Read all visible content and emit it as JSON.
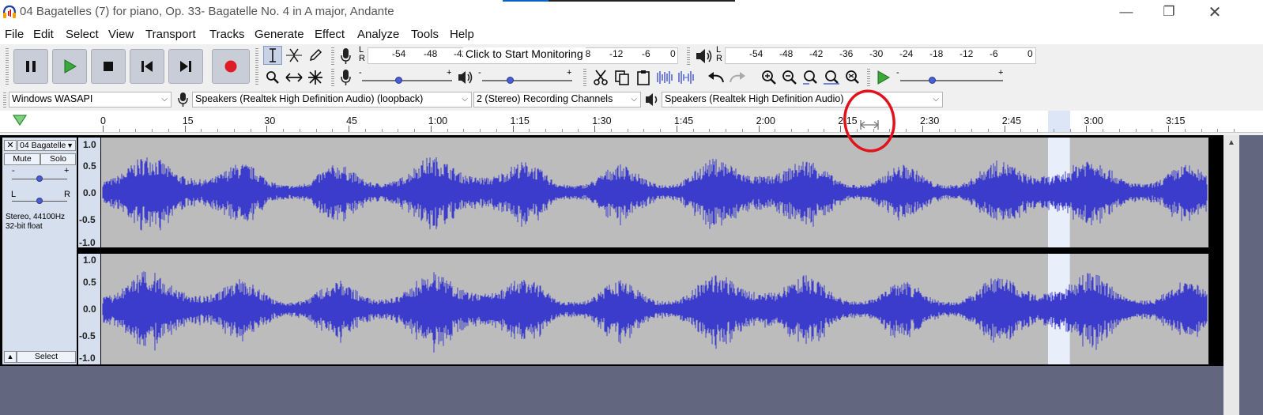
{
  "window": {
    "title": "04 Bagatelles (7) for piano, Op. 33- Bagatelle No. 4 in A major, Andante",
    "minimize_icon": "minimize-icon",
    "maximize_icon": "restore-icon",
    "close_icon": "close-icon"
  },
  "menu": [
    "File",
    "Edit",
    "Select",
    "View",
    "Transport",
    "Tracks",
    "Generate",
    "Effect",
    "Analyze",
    "Tools",
    "Help"
  ],
  "transport": {
    "buttons": [
      "pause",
      "play",
      "stop",
      "skip-to-start",
      "skip-to-end",
      "record"
    ]
  },
  "tools": {
    "row1": [
      "selection-tool",
      "envelope-tool",
      "draw-tool"
    ],
    "row2": [
      "zoom-tool",
      "time-shift-tool",
      "multi-tool"
    ]
  },
  "recording_meter": {
    "lr": "L\nR",
    "ticks": [
      "-54",
      "-48",
      "-42",
      "18",
      "-12",
      "-6",
      "0"
    ],
    "monitor_text": "Click to Start Monitoring"
  },
  "playback_meter": {
    "lr": "L\nR",
    "ticks": [
      "-54",
      "-48",
      "-42",
      "-36",
      "-30",
      "-24",
      "-18",
      "-12",
      "-6",
      "0"
    ]
  },
  "mixer": {
    "record_volume": 0.4,
    "playback_volume": 0.3
  },
  "edit_toolbar": [
    "cut",
    "copy",
    "paste",
    "trim",
    "silence",
    "undo",
    "redo",
    "zoom-in",
    "zoom-out",
    "fit-selection",
    "fit-project",
    "zoom-toggle"
  ],
  "play_at_speed": {
    "speed": 0.3
  },
  "device": {
    "host": "Windows WASAPI",
    "recording_device": "Speakers (Realtek High Definition Audio) (loopback)",
    "channels": "2 (Stereo) Recording Channels",
    "playback_device": "Speakers (Realtek High Definition Audio)"
  },
  "timeline": {
    "ticks": [
      "0",
      "15",
      "30",
      "45",
      "1:00",
      "1:15",
      "1:30",
      "1:45",
      "2:00",
      "2:15",
      "2:30",
      "2:45",
      "3:00",
      "3:15"
    ],
    "selection_start_s": 173,
    "selection_end_s": 177
  },
  "track": {
    "name": "04 Bagatelle",
    "mute": "Mute",
    "solo": "Solo",
    "gain_minus": "-",
    "gain_plus": "+",
    "pan_left": "L",
    "pan_right": "R",
    "info_line1": "Stereo, 44100Hz",
    "info_line2": "32-bit float",
    "select": "Select",
    "scale": [
      "1.0",
      "0.5",
      "0.0",
      "-0.5",
      "-1.0"
    ],
    "waveform_color": "#3c3ccc",
    "selection_color": "#e8eefa",
    "background_color": "#bcbcbc"
  },
  "annotation": {
    "color": "#e0121c"
  }
}
